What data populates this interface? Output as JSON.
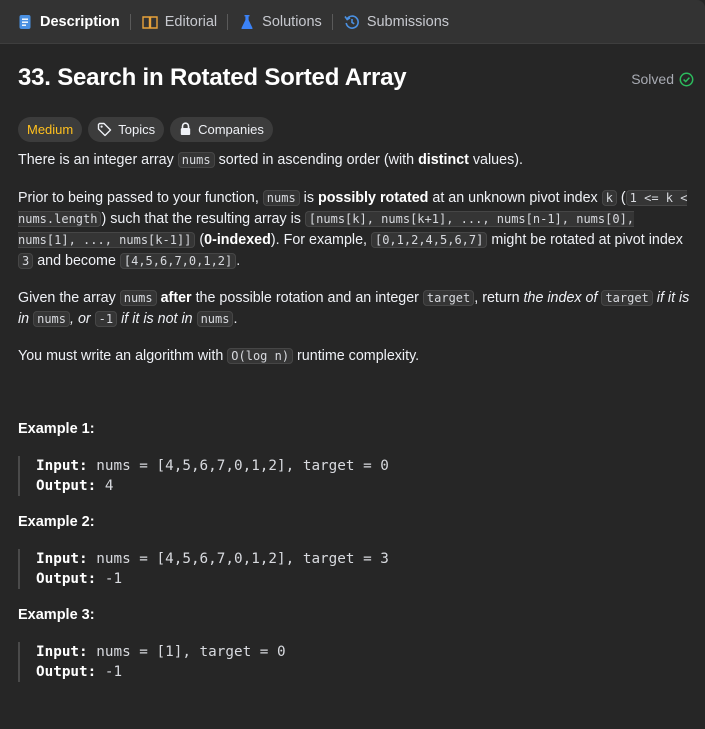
{
  "tabs": [
    {
      "label": "Description",
      "icon": "description-icon",
      "active": true
    },
    {
      "label": "Editorial",
      "icon": "book-icon",
      "active": false
    },
    {
      "label": "Solutions",
      "icon": "flask-icon",
      "active": false
    },
    {
      "label": "Submissions",
      "icon": "history-icon",
      "active": false
    }
  ],
  "problem": {
    "title": "33. Search in Rotated Sorted Array",
    "status": "Solved",
    "difficulty": "Medium",
    "topics_label": "Topics",
    "companies_label": "Companies"
  },
  "description": {
    "p1": {
      "t1": "There is an integer array ",
      "c1": "nums",
      "t2": " sorted in ascending order (with ",
      "b1": "distinct",
      "t3": " values)."
    },
    "p2": {
      "t1": "Prior to being passed to your function, ",
      "c1": "nums",
      "t2": " is ",
      "b1": "possibly rotated",
      "t3": " at an unknown pivot index ",
      "c2": "k",
      "t4": " (",
      "c3": "1 <= k < nums.length",
      "t5": ") such that the resulting array is ",
      "c4": "[nums[k], nums[k+1], ..., nums[n-1], nums[0], nums[1], ..., nums[k-1]]",
      "t6": " (",
      "b2": "0-indexed",
      "t7": "). For example, ",
      "c5": "[0,1,2,4,5,6,7]",
      "t8": " might be rotated at pivot index ",
      "c6": "3",
      "t9": " and become ",
      "c7": "[4,5,6,7,0,1,2]",
      "t10": "."
    },
    "p3": {
      "t1": "Given the array ",
      "c1": "nums",
      "t2": " ",
      "b1": "after",
      "t3": " the possible rotation and an integer ",
      "c2": "target",
      "t4": ", return ",
      "i1": "the index of ",
      "c3": "target",
      "i2": " if it is in ",
      "c4": "nums",
      "i3": ", or ",
      "c5": "-1",
      "i4": " if it is not in ",
      "c6": "nums",
      "t5": "."
    },
    "p4": {
      "t1": "You must write an algorithm with ",
      "c1": "O(log n)",
      "t2": " runtime complexity."
    }
  },
  "examples": [
    {
      "title": "Example 1:",
      "input_label": "Input:",
      "input": "nums = [4,5,6,7,0,1,2], target = 0",
      "output_label": "Output:",
      "output": "4"
    },
    {
      "title": "Example 2:",
      "input_label": "Input:",
      "input": "nums = [4,5,6,7,0,1,2], target = 3",
      "output_label": "Output:",
      "output": "-1"
    },
    {
      "title": "Example 3:",
      "input_label": "Input:",
      "input": "nums = [1], target = 0",
      "output_label": "Output:",
      "output": "-1"
    }
  ],
  "colors": {
    "background": "#262626",
    "tabbar": "#333333",
    "medium": "#ffc01e",
    "solved_check": "#2cbb5d",
    "solutions_icon": "#3b82f6",
    "submissions_icon": "#4a90e2"
  }
}
